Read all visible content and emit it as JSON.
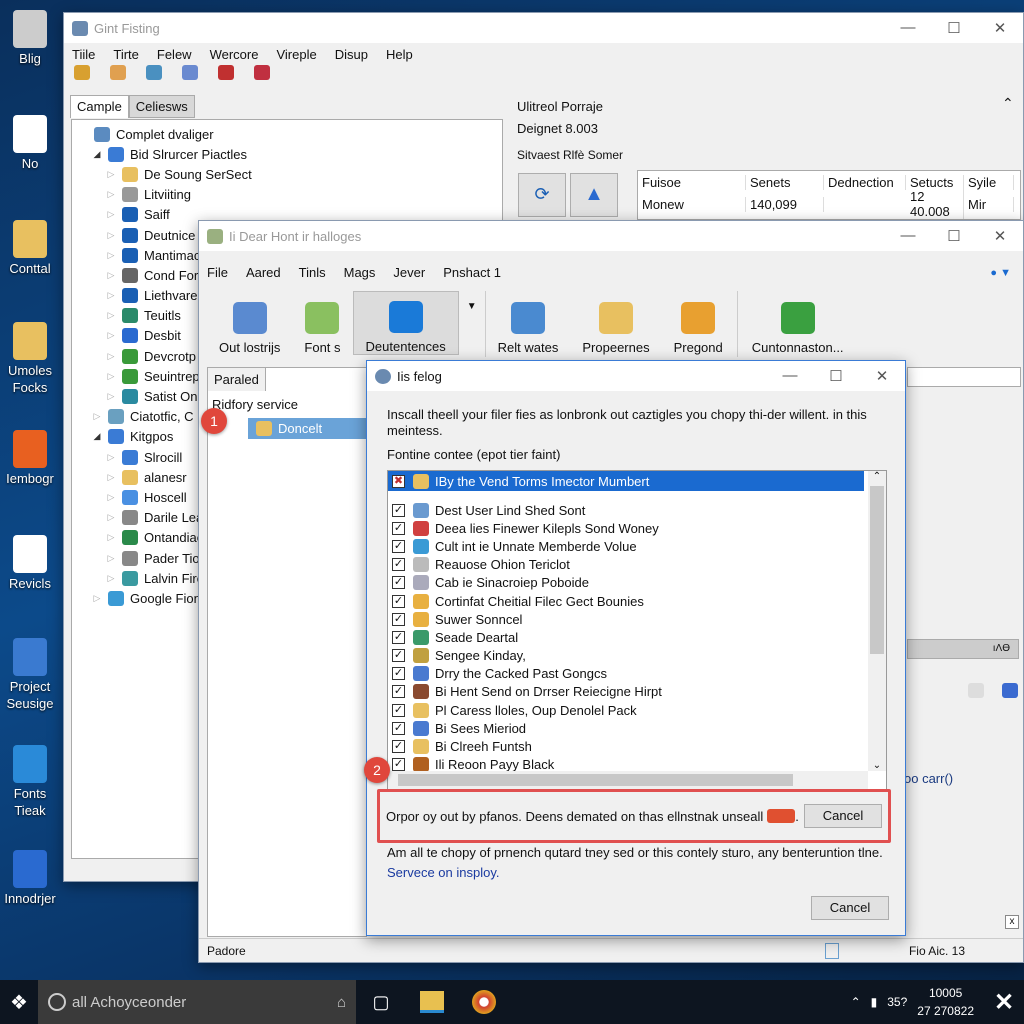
{
  "desktop": {
    "icons": [
      {
        "label": "Blig"
      },
      {
        "label": "No"
      },
      {
        "label": "Conttal"
      },
      {
        "label": "Umoles Focks"
      },
      {
        "label": "Iembogr"
      },
      {
        "label": "Revicls"
      },
      {
        "label": "Project Seusige"
      },
      {
        "label": "Fonts Tieak"
      },
      {
        "label": "Innodrjer"
      }
    ]
  },
  "back_window": {
    "title": "Gint Fisting",
    "menu": [
      "Tiile",
      "Tirte",
      "Felew",
      "Wercore",
      "Vireple",
      "Disup",
      "Help"
    ],
    "tabs": [
      "Cample",
      "Celiesws"
    ],
    "tree": [
      {
        "label": "Complet dvaliger",
        "level": 0,
        "icon": "drive-icon",
        "color": "#5b8bc0"
      },
      {
        "label": "Bid Slrurcer Piactles",
        "level": 1,
        "expanded": true,
        "icon": "network-icon",
        "color": "#3a7bd5"
      },
      {
        "label": "De Soung SerSect",
        "level": 2,
        "icon": "folder-icon",
        "color": "#e8c060"
      },
      {
        "label": "Litviiting",
        "level": 2,
        "icon": "drive-icon",
        "color": "#999"
      },
      {
        "label": "Saiff",
        "level": 2,
        "icon": "search-icon",
        "color": "#1a5fb4"
      },
      {
        "label": "Deutnice",
        "level": 2,
        "icon": "brush-icon",
        "color": "#1a5fb4"
      },
      {
        "label": "Mantimac",
        "level": 2,
        "icon": "pen-icon",
        "color": "#1a5fb4"
      },
      {
        "label": "Cond For",
        "level": 2,
        "icon": "key-icon",
        "color": "#666"
      },
      {
        "label": "Liethvare",
        "level": 2,
        "icon": "tool-icon",
        "color": "#1a5fb4"
      },
      {
        "label": "Teuitls",
        "level": 2,
        "icon": "tool-icon",
        "color": "#2a8a6a"
      },
      {
        "label": "Desbit",
        "level": 2,
        "icon": "tool-icon",
        "color": "#2a6ad0"
      },
      {
        "label": "Devcrotp",
        "level": 2,
        "icon": "gear-icon",
        "color": "#3a9a3a"
      },
      {
        "label": "Seuintrep",
        "level": 2,
        "icon": "gear-icon",
        "color": "#3a9a3a"
      },
      {
        "label": "Satist Ond",
        "level": 2,
        "icon": "gear-icon",
        "color": "#2a8aa0"
      },
      {
        "label": "Ciatotfic, C",
        "level": 1,
        "icon": "drive-icon",
        "color": "#6aa0c0"
      },
      {
        "label": "Kitgpos",
        "level": 1,
        "expanded": true,
        "icon": "users-icon",
        "color": "#3a7bd5"
      },
      {
        "label": "Slrocill",
        "level": 2,
        "icon": "network-icon",
        "color": "#3a7bd5"
      },
      {
        "label": "alanesr",
        "level": 2,
        "icon": "folder-icon",
        "color": "#e8c060"
      },
      {
        "label": "Hoscell",
        "level": 2,
        "icon": "window-icon",
        "color": "#4a90e2"
      },
      {
        "label": "Darile Lea",
        "level": 2,
        "icon": "drive-icon",
        "color": "#888"
      },
      {
        "label": "Ontandiae",
        "level": 2,
        "icon": "calendar-icon",
        "color": "#2a8a4a"
      },
      {
        "label": "Pader Tio",
        "level": 2,
        "icon": "download-icon",
        "color": "#888"
      },
      {
        "label": "Lalvin Fire",
        "level": 2,
        "icon": "image-icon",
        "color": "#3a9aa0"
      },
      {
        "label": "Google Fionts",
        "level": 1,
        "icon": "keyboard-icon",
        "color": "#3a9ad5"
      }
    ],
    "right": {
      "heading": "Ulitreol Porraje",
      "version": "Deignet 8.003",
      "section": "Sitvaest Rlfè Somer",
      "table": {
        "columns": [
          "Fuisoe",
          "Senets",
          "Dednection",
          "Setucts",
          "Syile"
        ],
        "rows": [
          [
            "Monew",
            "140,099",
            "",
            "12 40.008",
            "Mir"
          ]
        ]
      }
    }
  },
  "mid_window": {
    "title": "Ii Dear Hont ir halloges",
    "menu": [
      "File",
      "Aared",
      "Tinls",
      "Mags",
      "Jever",
      "Pnshact 1"
    ],
    "ribbon": [
      {
        "label": "Out lostrijs",
        "color": "#5a8ad0"
      },
      {
        "label": "Font s",
        "color": "#8ac060"
      },
      {
        "label": "Deutentences",
        "color": "#1a7ad8",
        "active": true
      },
      {
        "label": "Relt wates",
        "color": "#4a8ad0"
      },
      {
        "label": "Propeernes",
        "color": "#e8c060"
      },
      {
        "label": "Pregond",
        "color": "#e8a030"
      },
      {
        "label": "Cuntonnaston...",
        "color": "#3aa040"
      }
    ],
    "pane_tab": "Paraled",
    "tree_header": "Ridfory service",
    "selected_item": "Doncelt",
    "right_text": "oo carr()",
    "status_left": "Padore",
    "status_right": "Fio Aic. 13"
  },
  "dialog": {
    "title": "Iis felog",
    "description": "Inscall theell your filer fies as lonbronk out caztigles you chopy thi-der willent. in this meintess.",
    "list_label": "Fontine contee (epot tier faint)",
    "header_item": "IBy the Vend Torms Imector Mumbert",
    "items": [
      {
        "label": "Dest User Lind Shed Sont",
        "color": "#6a9ad0"
      },
      {
        "label": "Deea lies Finewer Kilepls Sond Woney",
        "color": "#d04040"
      },
      {
        "label": "Cult int ie Unnate Memberde Volue",
        "color": "#3a9ad5"
      },
      {
        "label": "Reauose Ohion Tericlot",
        "color": "#bbb"
      },
      {
        "label": "Cab ie Sinacroiep Poboide",
        "color": "#aab"
      },
      {
        "label": "Cortinfat Cheitial Filec Gect Bounies",
        "color": "#e8b040"
      },
      {
        "label": "Suwer Sonncel",
        "color": "#e8b040"
      },
      {
        "label": "Seade Deartal",
        "color": "#3a9a6a"
      },
      {
        "label": "Sengee Kinday,",
        "color": "#c0a040"
      },
      {
        "label": "Drry the Cacked Past Gongcs",
        "color": "#4a7ad0"
      },
      {
        "label": "Bi Hent Send on Drrser Reiecigne Hirpt",
        "color": "#8a4a30"
      },
      {
        "label": "Pl Caress lloles, Oup Denolel Pack",
        "color": "#e8c060"
      },
      {
        "label": "Bi Sees Mieriod",
        "color": "#4a7ad0"
      },
      {
        "label": "Bi Clreeh Funtsh",
        "color": "#e8c060"
      },
      {
        "label": "Ili Reoon Payy Black",
        "color": "#b06020"
      }
    ],
    "notice": "Orpor oy out by pfanos. Deens demated on thas ellnstnak unseall",
    "notice_cancel": "Cancel",
    "info": "Am all te chopy of prnench qutard tney sed or this contely sturo, any benteruntion tlne.",
    "link": "Servece on insploy.",
    "cancel": "Cancel",
    "badges": [
      "1",
      "2"
    ],
    "highlight_color": "#e05050"
  },
  "taskbar": {
    "search_placeholder": "all Achoyceonder",
    "tray_num": "35?",
    "time": "10005",
    "date": "27 270822"
  }
}
